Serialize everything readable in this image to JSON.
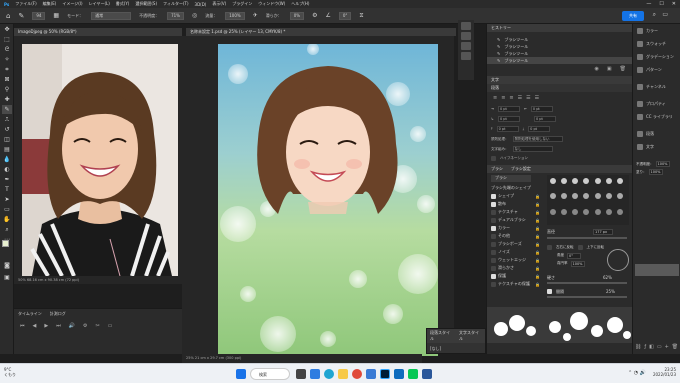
{
  "menubar": {
    "app_icon": "Ps",
    "items": [
      "ファイル(F)",
      "編集(E)",
      "イメージ(I)",
      "レイヤー(L)",
      "書式(Y)",
      "選択範囲(S)",
      "フィルター(T)",
      "3D(D)",
      "表示(V)",
      "プラグイン",
      "ウィンドウ(W)",
      "ヘルプ(H)"
    ],
    "window_controls": [
      "—",
      "☐",
      "✕"
    ]
  },
  "options_bar": {
    "brush_size": "94",
    "mode_label": "モード：",
    "mode_value": "通常",
    "opacity_label": "不透明度：",
    "opacity_value": "71%",
    "flow_label": "流量：",
    "flow_value": "100%",
    "smoothing_label": "滑らか：",
    "smoothing_value": "0%",
    "angle_value": "0°",
    "share_label": "共有"
  },
  "doc1": {
    "tab_title": "ImageDjpeg @ 50% (RGB/8*)",
    "status": "50%  68.16 cm x 90.38 cm (72 ppi)"
  },
  "doc2": {
    "tab_title": "名称未設定 1.psd @ 25% (レイヤー 13, CMYK/8) *",
    "status": "25%  21 cm x 29.7 cm (300 ppi)"
  },
  "timeline": {
    "tabs": [
      "タイムライン",
      "計測ログ"
    ],
    "controls": [
      "⏮",
      "◀",
      "▶",
      "⏭",
      "🔊",
      "⚙",
      "✂",
      "▭"
    ]
  },
  "mini_panel": {
    "tabs": [
      "段落スタイル",
      "文字スタイル"
    ],
    "item": "[なし]"
  },
  "history": {
    "title": "ヒストリー",
    "items": [
      "ブラシツール",
      "ブラシツール",
      "ブラシツール",
      "ブラシツール"
    ]
  },
  "properties": {
    "tabs": [
      "文字",
      "段落"
    ],
    "fields": [
      [
        "0 pt",
        "0 pt"
      ],
      [
        "0 pt",
        "0 pt"
      ],
      [
        "0 pt",
        "0 pt"
      ]
    ],
    "hyphenation_label": "禁則処理：",
    "hyphenation_value": "禁則処理を使用しない",
    "mojikumi_label": "文字組み：",
    "mojikumi_value": "なし",
    "hyphenate_label": "ハイフネーション"
  },
  "brush_settings": {
    "tabs": [
      "ブラシ",
      "ブラシ設定"
    ],
    "sub_tab": "ブラシ",
    "options": [
      {
        "label": "ブラシ先端のシェイプ",
        "checked": true
      },
      {
        "label": "シェイプ",
        "checked": true
      },
      {
        "label": "散布",
        "checked": true
      },
      {
        "label": "テクスチャ",
        "checked": false
      },
      {
        "label": "デュアルブラシ",
        "checked": false
      },
      {
        "label": "カラー",
        "checked": true
      },
      {
        "label": "その他",
        "checked": false
      },
      {
        "label": "ブラシポーズ",
        "checked": false
      },
      {
        "label": "ノイズ",
        "checked": false
      },
      {
        "label": "ウェットエッジ",
        "checked": false
      },
      {
        "label": "滑らかさ",
        "checked": false
      },
      {
        "label": "保護",
        "checked": true
      },
      {
        "label": "テクスチャの保護",
        "checked": false
      }
    ],
    "diameter_label": "直径",
    "diameter_value": "177 px",
    "flip_x": "左右に反転",
    "flip_y": "上下に反転",
    "angle_label": "角度",
    "angle_value": "0°",
    "roundness_label": "真円率",
    "roundness_value": "100%",
    "hardness_label": "硬さ",
    "hardness_value": "62%",
    "spacing_label": "間隔",
    "spacing_value": "25%"
  },
  "right_column": {
    "items": [
      {
        "icon": "color-icon",
        "label": "カラー"
      },
      {
        "icon": "swatches-icon",
        "label": "スウォッチ"
      },
      {
        "icon": "gradient-icon",
        "label": "グラデーション"
      },
      {
        "icon": "patterns-icon",
        "label": "パターン"
      },
      {
        "icon": "channels-icon",
        "label": "チャンネル"
      },
      {
        "icon": "properties-icon",
        "label": "プロパティ"
      },
      {
        "icon": "libraries-icon",
        "label": "CC ライブラリ"
      },
      {
        "icon": "paragraph-icon",
        "label": "段落"
      },
      {
        "icon": "character-icon",
        "label": "文字"
      }
    ],
    "opacity_label": "不透明度：",
    "opacity_value": "100%",
    "fill_label": "塗り：",
    "fill_value": "100%"
  },
  "taskbar": {
    "weather_temp": "9°C",
    "weather_desc": "くもり",
    "search_label": "検索",
    "time": "23:25",
    "date": "2022/01/23"
  }
}
